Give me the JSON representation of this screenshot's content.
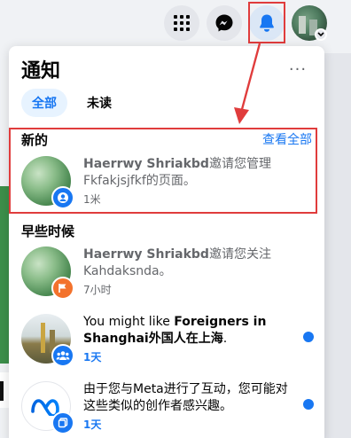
{
  "topbar": {
    "icons": [
      "apps-grid-icon",
      "messenger-icon",
      "bell-icon",
      "profile-avatar"
    ]
  },
  "panel": {
    "title": "通知",
    "more_label": "···",
    "tabs": [
      {
        "label": "全部",
        "active": true
      },
      {
        "label": "未读",
        "active": false
      }
    ],
    "sections": {
      "new": {
        "header": "新的",
        "see_all": "查看全部"
      },
      "earlier": {
        "header": "早些时候"
      }
    },
    "notifications": [
      {
        "name": "Haerrwy Shriakbd",
        "text": "邀请您管理Fkfakjsjfkf的页面。",
        "time": "1米",
        "unread": false,
        "badge": "profile-icon"
      },
      {
        "name": "Haerrwy Shriakbd",
        "text": "邀请您关注Kahdaksnda。",
        "time": "7小时",
        "unread": false,
        "badge": "flag-icon"
      },
      {
        "prefix": "You might like ",
        "name": "Foreigners in Shanghai外国人在上海",
        "suffix": ".",
        "time": "1天",
        "unread": true,
        "badge": "group-icon"
      },
      {
        "text": "由于您与Meta进行了互动，您可能对这些类似的创作者感兴趣。",
        "time": "1天",
        "unread": true,
        "badge": "pages-icon"
      }
    ]
  },
  "colors": {
    "accent": "#1877f2",
    "highlight": "#e03c3c",
    "badge_orange": "#f3722c"
  }
}
